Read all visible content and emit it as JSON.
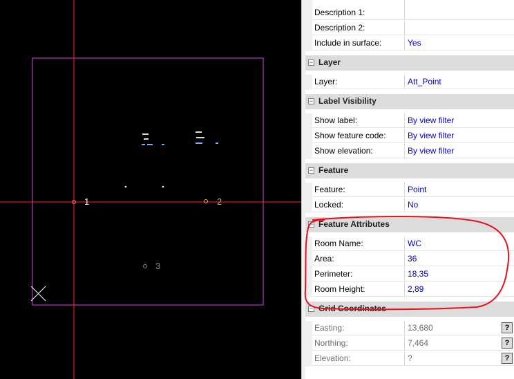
{
  "viewport": {
    "points": [
      {
        "number": "1",
        "color": "#ffffff",
        "ring": "#ff7070"
      },
      {
        "number": "2",
        "color": "#ff9933",
        "ring": "#ff9933"
      },
      {
        "number": "3",
        "color": "#8a8a8a",
        "ring": "#8a8a8a"
      }
    ],
    "colors": {
      "crosshair": "#ff2020",
      "rectangle": "#e040e0",
      "marker": "#ffffff"
    }
  },
  "properties": {
    "top_rows": [
      {
        "name": "Description 1:",
        "value": ""
      },
      {
        "name": "Description 2:",
        "value": ""
      },
      {
        "name": "Include in surface:",
        "value": "Yes"
      }
    ],
    "layer": {
      "title": "Layer",
      "rows": [
        {
          "name": "Layer:",
          "value": "Att_Point"
        }
      ]
    },
    "label_visibility": {
      "title": "Label Visibility",
      "rows": [
        {
          "name": "Show label:",
          "value": "By view filter"
        },
        {
          "name": "Show feature code:",
          "value": "By view filter"
        },
        {
          "name": "Show elevation:",
          "value": "By view filter"
        }
      ]
    },
    "feature": {
      "title": "Feature",
      "rows": [
        {
          "name": "Feature:",
          "value": "Point"
        },
        {
          "name": "Locked:",
          "value": "No"
        }
      ]
    },
    "feature_attributes": {
      "title": "Feature Attributes",
      "rows": [
        {
          "name": "Room Name:",
          "value": "WC"
        },
        {
          "name": "Area:",
          "value": "36"
        },
        {
          "name": "Perimeter:",
          "value": "18,35"
        },
        {
          "name": "Room Height:",
          "value": "2,89"
        }
      ]
    },
    "grid_coordinates": {
      "title": "Grid Coordinates",
      "rows": [
        {
          "name": "Easting:",
          "value": "13,680",
          "button": "?"
        },
        {
          "name": "Northing:",
          "value": "7,464",
          "button": "?"
        },
        {
          "name": "Elevation:",
          "value": "?",
          "button": "?"
        }
      ]
    },
    "collapse_glyph": "−"
  },
  "annotation": {
    "color": "#e8101c"
  }
}
